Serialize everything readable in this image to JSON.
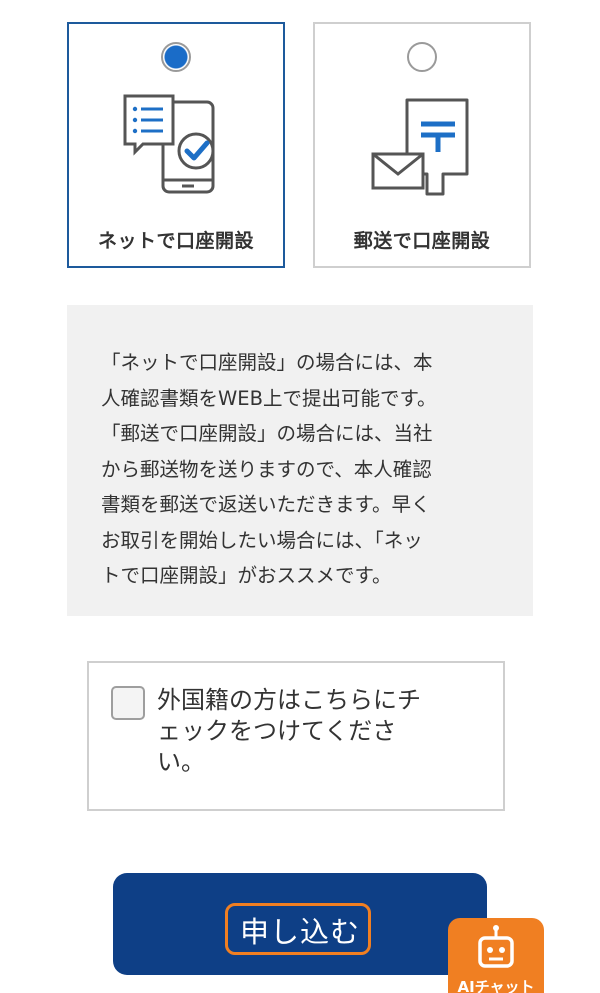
{
  "options": [
    {
      "label": "ネットで口座開設",
      "selected": true,
      "icon": "smartphone-check-icon"
    },
    {
      "label": "郵送で口座開設",
      "selected": false,
      "icon": "mail-post-icon"
    }
  ],
  "info": {
    "text": "「ネットで口座開設」の場合には、本\n人確認書類をWEB上で提出可能です。\n「郵送で口座開設」の場合には、当社\nから郵送物を送りますので、本人確認\n書類を郵送で返送いただきます。早く\nお取引を開始したい場合には、「ネッ\nトで口座開設」がおススメです。"
  },
  "foreign": {
    "label": "外国籍の方はこちらにチ\nェックをつけてくださ\nい。",
    "checked": false
  },
  "submit": {
    "label": "申し込む"
  },
  "ai_chat": {
    "label": "AIチャット",
    "icon": "robot-icon"
  },
  "colors": {
    "accent": "#1d5a9c",
    "radio_selected": "#1a6cc8",
    "submit_bg": "#0e3f86",
    "highlight": "#f07f22",
    "info_bg": "#f1f1f1"
  }
}
